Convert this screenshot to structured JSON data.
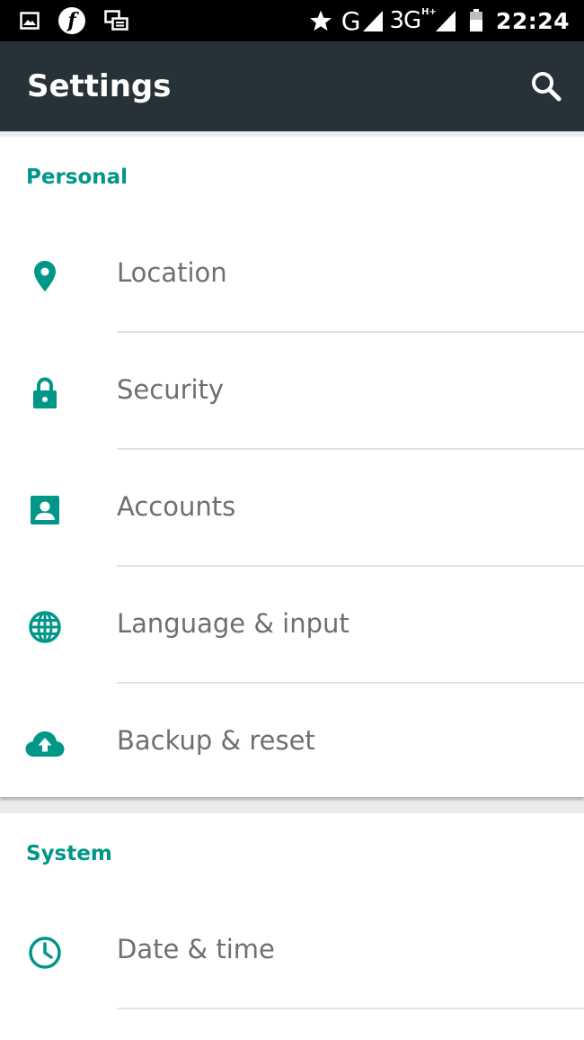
{
  "status_bar": {
    "time": "22:24",
    "network_g": "G",
    "network_3g": "3G",
    "network_hplus": "H+",
    "icons": [
      "gallery-icon",
      "flipkart-icon",
      "screen-mirror-icon",
      "star-icon",
      "signal-icon",
      "signal-3g-icon",
      "battery-icon"
    ]
  },
  "app_bar": {
    "title": "Settings",
    "search_icon": "search-icon"
  },
  "colors": {
    "accent": "#009688",
    "app_bar": "#263238",
    "status_bar": "#000000",
    "label": "#6f6f6f"
  },
  "sections": {
    "personal": {
      "header": "Personal",
      "items": [
        {
          "label": "Location",
          "icon": "location-pin-icon"
        },
        {
          "label": "Security",
          "icon": "lock-icon"
        },
        {
          "label": "Accounts",
          "icon": "account-box-icon"
        },
        {
          "label": "Language & input",
          "icon": "globe-icon"
        },
        {
          "label": "Backup & reset",
          "icon": "cloud-upload-icon"
        }
      ]
    },
    "system": {
      "header": "System",
      "items": [
        {
          "label": "Date & time",
          "icon": "clock-icon"
        }
      ]
    }
  }
}
